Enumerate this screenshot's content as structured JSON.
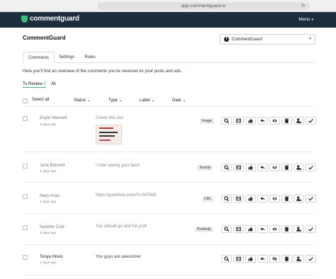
{
  "browser": {
    "url": "app.commentguard.io"
  },
  "navbar": {
    "brand": "commentguard",
    "menu_label": "Menu"
  },
  "page": {
    "title": "CommentGuard"
  },
  "account_select": {
    "value": "CommentGuard"
  },
  "tabs": [
    {
      "label": "Comments"
    },
    {
      "label": "Settings"
    },
    {
      "label": "Rules"
    }
  ],
  "overview": "Here you'll find an overview of the comments you've received on your posts and ads.",
  "subtabs": {
    "to_review": "To Review",
    "to_review_count": "5",
    "all": "All"
  },
  "columns": {
    "select_all": "Select all",
    "status": "Status",
    "type": "Type",
    "label": "Label",
    "date": "Date"
  },
  "comments": [
    {
      "author": "Doyle Maxwell",
      "ago": "3 days ago",
      "text": "Check this out:",
      "label": "Image"
    },
    {
      "author": "June Bennett",
      "ago": "4 days ago",
      "text": "I hate seeing your face!",
      "label": "Toxicity"
    },
    {
      "author": "Mary Arias",
      "ago": "4 days ago",
      "text": "https://gramfree.com/?r=547943",
      "label": "URL"
    },
    {
      "author": "Nanette Cole",
      "ago": "4 days ago",
      "text": "You should go and fck yrslf",
      "label": "Profanity"
    },
    {
      "author": "Tonya Hovis",
      "ago": "4 days ago",
      "text": "You guys are awesome!",
      "label": ""
    }
  ],
  "action_icons": [
    "search-icon",
    "id-card-icon",
    "thumbs-up-icon",
    "reply-icon",
    "eye-icon",
    "trash-icon",
    "user-block-icon",
    "check-icon"
  ],
  "colors": {
    "navbar": "#1d2d3f",
    "brand_accent": "#35c07a"
  }
}
